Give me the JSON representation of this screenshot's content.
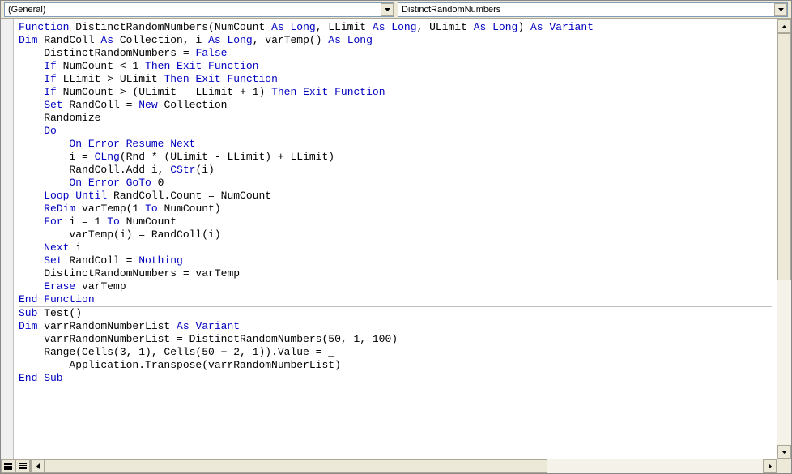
{
  "toolbar": {
    "object_combo": "(General)",
    "procedure_combo": "DistinctRandomNumbers"
  },
  "code": {
    "tokens": [
      [
        [
          "kw",
          "Function"
        ],
        [
          "",
          " DistinctRandomNumbers(NumCount "
        ],
        [
          "kw",
          "As Long"
        ],
        [
          "",
          ", LLimit "
        ],
        [
          "kw",
          "As Long"
        ],
        [
          "",
          ", ULimit "
        ],
        [
          "kw",
          "As Long"
        ],
        [
          "",
          ") "
        ],
        [
          "kw",
          "As Variant"
        ]
      ],
      [
        [
          "kw",
          "Dim"
        ],
        [
          "",
          " RandColl "
        ],
        [
          "kw",
          "As"
        ],
        [
          "",
          " Collection, i "
        ],
        [
          "kw",
          "As Long"
        ],
        [
          "",
          ", varTemp() "
        ],
        [
          "kw",
          "As Long"
        ]
      ],
      [
        [
          "",
          "    DistinctRandomNumbers = "
        ],
        [
          "kw",
          "False"
        ]
      ],
      [
        [
          "",
          "    "
        ],
        [
          "kw",
          "If"
        ],
        [
          "",
          " NumCount < 1 "
        ],
        [
          "kw",
          "Then Exit Function"
        ]
      ],
      [
        [
          "",
          "    "
        ],
        [
          "kw",
          "If"
        ],
        [
          "",
          " LLimit > ULimit "
        ],
        [
          "kw",
          "Then Exit Function"
        ]
      ],
      [
        [
          "",
          "    "
        ],
        [
          "kw",
          "If"
        ],
        [
          "",
          " NumCount > (ULimit - LLimit + 1) "
        ],
        [
          "kw",
          "Then Exit Function"
        ]
      ],
      [
        [
          "",
          "    "
        ],
        [
          "kw",
          "Set"
        ],
        [
          "",
          " RandColl = "
        ],
        [
          "kw",
          "New"
        ],
        [
          "",
          " Collection"
        ]
      ],
      [
        [
          "",
          "    Randomize"
        ]
      ],
      [
        [
          "",
          "    "
        ],
        [
          "kw",
          "Do"
        ]
      ],
      [
        [
          "",
          "        "
        ],
        [
          "kw",
          "On Error Resume Next"
        ]
      ],
      [
        [
          "",
          "        i = "
        ],
        [
          "kw",
          "CLng"
        ],
        [
          "",
          "(Rnd * (ULimit - LLimit) + LLimit)"
        ]
      ],
      [
        [
          "",
          "        RandColl.Add i, "
        ],
        [
          "kw",
          "CStr"
        ],
        [
          "",
          "(i)"
        ]
      ],
      [
        [
          "",
          "        "
        ],
        [
          "kw",
          "On Error GoTo"
        ],
        [
          "",
          " 0"
        ]
      ],
      [
        [
          "",
          "    "
        ],
        [
          "kw",
          "Loop Until"
        ],
        [
          "",
          " RandColl.Count = NumCount"
        ]
      ],
      [
        [
          "",
          "    "
        ],
        [
          "kw",
          "ReDim"
        ],
        [
          "",
          " varTemp(1 "
        ],
        [
          "kw",
          "To"
        ],
        [
          "",
          " NumCount)"
        ]
      ],
      [
        [
          "",
          "    "
        ],
        [
          "kw",
          "For"
        ],
        [
          "",
          " i = 1 "
        ],
        [
          "kw",
          "To"
        ],
        [
          "",
          " NumCount"
        ]
      ],
      [
        [
          "",
          "        varTemp(i) = RandColl(i)"
        ]
      ],
      [
        [
          "",
          "    "
        ],
        [
          "kw",
          "Next"
        ],
        [
          "",
          " i"
        ]
      ],
      [
        [
          "",
          "    "
        ],
        [
          "kw",
          "Set"
        ],
        [
          "",
          " RandColl = "
        ],
        [
          "kw",
          "Nothing"
        ]
      ],
      [
        [
          "",
          "    DistinctRandomNumbers = varTemp"
        ]
      ],
      [
        [
          "",
          "    "
        ],
        [
          "kw",
          "Erase"
        ],
        [
          "",
          " varTemp"
        ]
      ],
      [
        [
          "kw",
          "End Function"
        ]
      ],
      "__hr__",
      [
        [
          "",
          ""
        ]
      ],
      [
        [
          "kw",
          "Sub"
        ],
        [
          "",
          " Test()"
        ]
      ],
      [
        [
          "kw",
          "Dim"
        ],
        [
          "",
          " varrRandomNumberList "
        ],
        [
          "kw",
          "As Variant"
        ]
      ],
      [
        [
          "",
          "    varrRandomNumberList = DistinctRandomNumbers(50, 1, 100)"
        ]
      ],
      [
        [
          "",
          "    Range(Cells(3, 1), Cells(50 + 2, 1)).Value = _"
        ]
      ],
      [
        [
          "",
          "        Application.Transpose(varrRandomNumberList)"
        ]
      ],
      [
        [
          "kw",
          "End Sub"
        ]
      ]
    ]
  },
  "chart_data": null
}
